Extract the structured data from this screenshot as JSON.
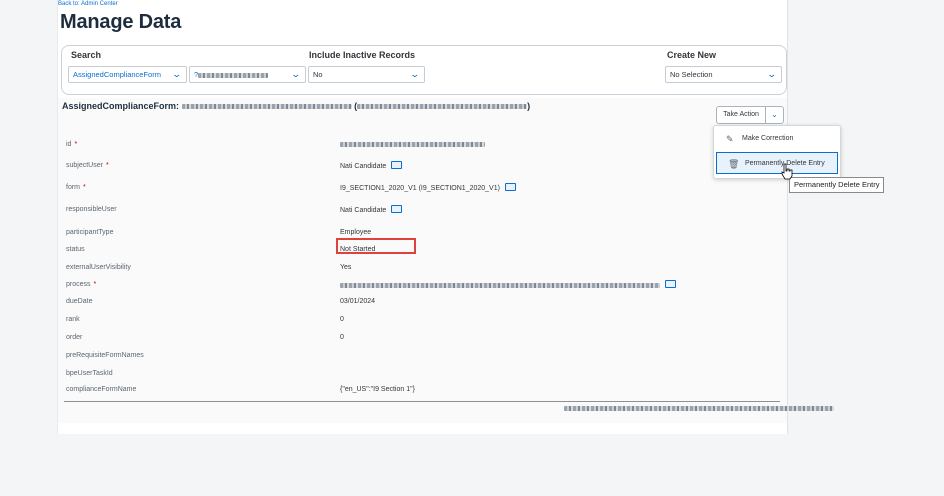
{
  "back_link": "Back to: Admin Center",
  "page_title": "Manage Data",
  "filters": {
    "search_label": "Search",
    "search_type_value": "AssignedComplianceForm",
    "search_record_value": "?",
    "inactive_label": "Include Inactive Records",
    "inactive_value": "No",
    "create_label": "Create New",
    "create_value": "No Selection"
  },
  "record": {
    "title_prefix": "AssignedComplianceForm:",
    "take_action_label": "Take Action",
    "fields": [
      {
        "label": "id",
        "required": "*",
        "value": ""
      },
      {
        "label": "subjectUser",
        "required": "*",
        "value": "Nati Candidate"
      },
      {
        "label": "form",
        "required": "*",
        "value": "I9_SECTION1_2020_V1 (I9_SECTION1_2020_V1)"
      },
      {
        "label": "responsibleUser",
        "required": "",
        "value": "Nati Candidate"
      },
      {
        "label": "participantType",
        "required": "",
        "value": "Employee"
      },
      {
        "label": "status",
        "required": "",
        "value": "Not Started"
      },
      {
        "label": "externalUserVisibility",
        "required": "",
        "value": "Yes"
      },
      {
        "label": "process",
        "required": "*",
        "value": ""
      },
      {
        "label": "dueDate",
        "required": "",
        "value": "03/01/2024"
      },
      {
        "label": "rank",
        "required": "",
        "value": "0"
      },
      {
        "label": "order",
        "required": "",
        "value": "0"
      },
      {
        "label": "preRequisiteFormNames",
        "required": "",
        "value": ""
      },
      {
        "label": "bpeUserTaskId",
        "required": "",
        "value": ""
      },
      {
        "label": "complianceFormName",
        "required": "",
        "value": "{\"en_US\":\"I9 Section 1\"}"
      }
    ]
  },
  "menu": {
    "make_correction": "Make Correction",
    "permanently_delete": "Permanently Delete Entry"
  },
  "tooltip": "Permanently Delete Entry",
  "colors": {
    "accent": "#0a6ed1",
    "highlight_box": "#e0413f"
  }
}
